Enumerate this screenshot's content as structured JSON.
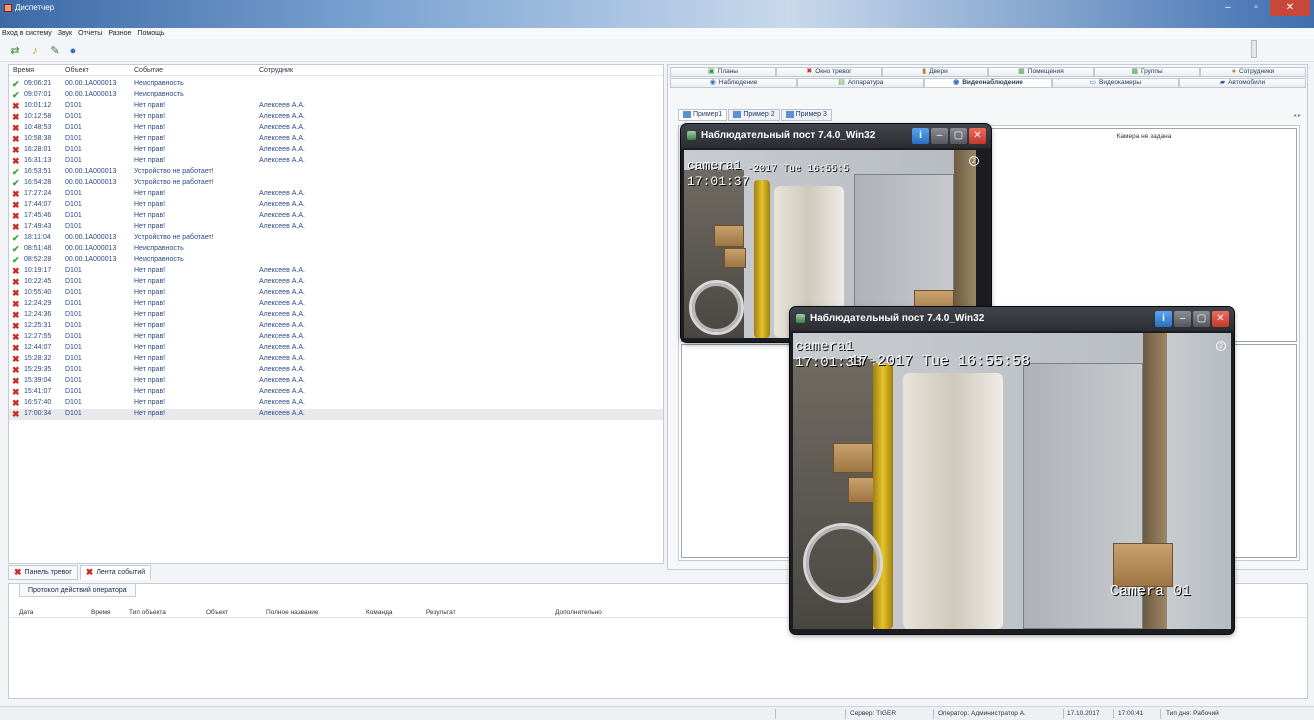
{
  "window": {
    "title": "Диспетчер"
  },
  "menu": [
    "Вход в систему",
    "Звук",
    "Отчеты",
    "Разное",
    "Помощь"
  ],
  "events": {
    "columns": [
      "Время",
      "Объект",
      "Событие",
      "Сотрудник"
    ],
    "rows": [
      {
        "status": "ok",
        "time": "09:06:21",
        "object": "00.00.1A000013",
        "event": "Неисправность",
        "employee": ""
      },
      {
        "status": "ok",
        "time": "09:07:01",
        "object": "00.00.1A000013",
        "event": "Неисправность",
        "employee": ""
      },
      {
        "status": "err",
        "time": "10:01:12",
        "object": "D101",
        "event": "Нет прав!",
        "employee": "Алексеев А.А."
      },
      {
        "status": "err",
        "time": "10:12:58",
        "object": "D101",
        "event": "Нет прав!",
        "employee": "Алексеев А.А."
      },
      {
        "status": "err",
        "time": "10:48:53",
        "object": "D101",
        "event": "Нет прав!",
        "employee": "Алексеев А.А."
      },
      {
        "status": "err",
        "time": "10:58:38",
        "object": "D101",
        "event": "Нет прав!",
        "employee": "Алексеев А.А."
      },
      {
        "status": "err",
        "time": "16:28:01",
        "object": "D101",
        "event": "Нет прав!",
        "employee": "Алексеев А.А."
      },
      {
        "status": "err",
        "time": "16:31:13",
        "object": "D101",
        "event": "Нет прав!",
        "employee": "Алексеев А.А."
      },
      {
        "status": "ok",
        "time": "16:53:51",
        "object": "00.00.1A000013",
        "event": "Устройство не работает!",
        "employee": ""
      },
      {
        "status": "ok",
        "time": "16:54:28",
        "object": "00.00.1A000013",
        "event": "Устройство не работает!",
        "employee": ""
      },
      {
        "status": "err",
        "time": "17:27:24",
        "object": "D101",
        "event": "Нет прав!",
        "employee": "Алексеев А.А."
      },
      {
        "status": "err",
        "time": "17:44:07",
        "object": "D101",
        "event": "Нет прав!",
        "employee": "Алексеев А.А."
      },
      {
        "status": "err",
        "time": "17:45:46",
        "object": "D101",
        "event": "Нет прав!",
        "employee": "Алексеев А.А."
      },
      {
        "status": "err",
        "time": "17:49:43",
        "object": "D101",
        "event": "Нет прав!",
        "employee": "Алексеев А.А."
      },
      {
        "status": "ok",
        "time": "18:11:04",
        "object": "00.00.1A000013",
        "event": "Устройство не работает!",
        "employee": ""
      },
      {
        "status": "ok",
        "time": "08:51:48",
        "object": "00.00.1A000013",
        "event": "Неисправность",
        "employee": ""
      },
      {
        "status": "ok",
        "time": "08:52:28",
        "object": "00.00.1A000013",
        "event": "Неисправность",
        "employee": ""
      },
      {
        "status": "err",
        "time": "10:19:17",
        "object": "D101",
        "event": "Нет прав!",
        "employee": "Алексеев А.А."
      },
      {
        "status": "err",
        "time": "10:22:45",
        "object": "D101",
        "event": "Нет прав!",
        "employee": "Алексеев А.А."
      },
      {
        "status": "err",
        "time": "10:55:40",
        "object": "D101",
        "event": "Нет прав!",
        "employee": "Алексеев А.А."
      },
      {
        "status": "err",
        "time": "12:24:29",
        "object": "D101",
        "event": "Нет прав!",
        "employee": "Алексеев А.А."
      },
      {
        "status": "err",
        "time": "12:24:36",
        "object": "D101",
        "event": "Нет прав!",
        "employee": "Алексеев А.А."
      },
      {
        "status": "err",
        "time": "12:25:31",
        "object": "D101",
        "event": "Нет прав!",
        "employee": "Алексеев А.А."
      },
      {
        "status": "err",
        "time": "12:27:55",
        "object": "D101",
        "event": "Нет прав!",
        "employee": "Алексеев А.А."
      },
      {
        "status": "err",
        "time": "12:44:07",
        "object": "D101",
        "event": "Нет прав!",
        "employee": "Алексеев А.А."
      },
      {
        "status": "err",
        "time": "15:28:32",
        "object": "D101",
        "event": "Нет прав!",
        "employee": "Алексеев А.А."
      },
      {
        "status": "err",
        "time": "15:29:35",
        "object": "D101",
        "event": "Нет прав!",
        "employee": "Алексеев А.А."
      },
      {
        "status": "err",
        "time": "15:39:04",
        "object": "D101",
        "event": "Нет прав!",
        "employee": "Алексеев А.А."
      },
      {
        "status": "err",
        "time": "15:41:07",
        "object": "D101",
        "event": "Нет прав!",
        "employee": "Алексеев А.А."
      },
      {
        "status": "err",
        "time": "16:57:40",
        "object": "D101",
        "event": "Нет прав!",
        "employee": "Алексеев А.А."
      },
      {
        "status": "err",
        "time": "17:00:34",
        "object": "D101",
        "event": "Нет прав!",
        "employee": "Алексеев А.А.",
        "selected": true
      }
    ]
  },
  "bottom_tabs": [
    "Панель тревог",
    "Лента событий"
  ],
  "protocol": {
    "tab": "Протокол действий оператора",
    "columns": [
      "Дата",
      "Время",
      "Тип объекта",
      "Объект",
      "Полное название",
      "Команда",
      "Результат",
      "Дополнительно"
    ]
  },
  "right": {
    "tabs_row1": [
      {
        "label": "Планы",
        "icon": "plans-icon"
      },
      {
        "label": "Окно тревог",
        "icon": "alarm-icon"
      },
      {
        "label": "Двери",
        "icon": "door-icon"
      },
      {
        "label": "Помещения",
        "icon": "rooms-icon"
      },
      {
        "label": "Группы",
        "icon": "groups-icon"
      },
      {
        "label": "Сотрудники",
        "icon": "employees-icon"
      }
    ],
    "tabs_row2": [
      {
        "label": "Наблюдение",
        "icon": "eye-icon"
      },
      {
        "label": "Аппаратура",
        "icon": "hardware-icon"
      },
      {
        "label": "Видеонаблюдение",
        "icon": "video-icon",
        "active": true
      },
      {
        "label": "Видеокамеры",
        "icon": "camera-icon"
      },
      {
        "label": "Автомобили",
        "icon": "car-icon"
      }
    ],
    "subtabs": [
      "Пример1",
      "Пример 2",
      "Пример 3"
    ],
    "camera_not_set": "Камера не задана"
  },
  "video_windows": [
    {
      "title": "Наблюдательный пост 7.4.0_Win32",
      "osd_name": "camera1",
      "osd_time": "17:01:37",
      "osd_stamp": "-2017 Tue 16:55:5"
    },
    {
      "title": "Наблюдательный пост 7.4.0_Win32",
      "osd_name": "camera1",
      "osd_time": "17:01:38",
      "osd_stamp": "17-2017 Tue 16:55:58",
      "osd_cam": "Camera 01"
    }
  ],
  "status": {
    "server": "Сервер: TIGER",
    "operator": "Оператор: Администратор А.",
    "date": "17.10.2017",
    "time": "17:00:41",
    "day_type": "Тип дня: Рабочий"
  },
  "colors": {
    "ok": "#39a63a",
    "err": "#c82a1d",
    "text": "#2b4a86"
  }
}
